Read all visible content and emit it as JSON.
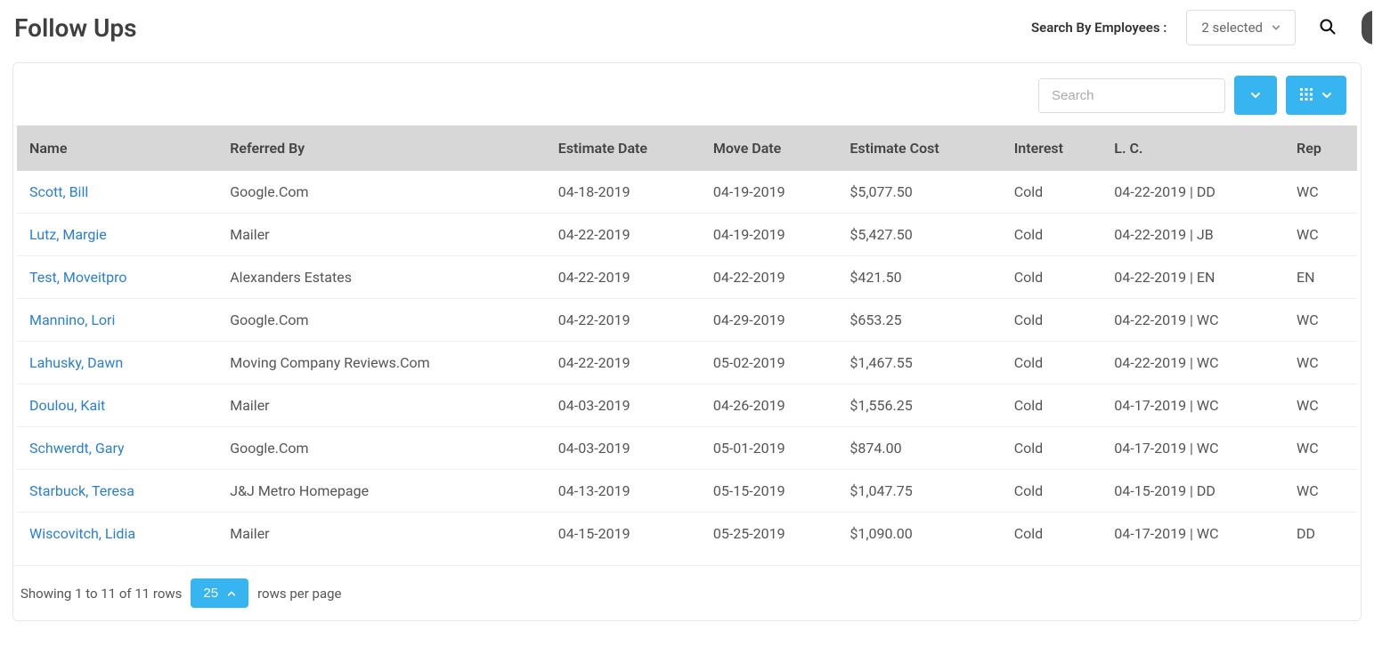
{
  "header": {
    "title": "Follow Ups",
    "searchByLabel": "Search By Employees :",
    "employeesSelected": "2 selected"
  },
  "toolbar": {
    "searchPlaceholder": "Search"
  },
  "table": {
    "columns": {
      "name": "Name",
      "referredBy": "Referred By",
      "estimateDate": "Estimate Date",
      "moveDate": "Move Date",
      "estimateCost": "Estimate Cost",
      "interest": "Interest",
      "lc": "L. C.",
      "rep": "Rep"
    },
    "rows": [
      {
        "name": "Scott, Bill",
        "referredBy": "Google.Com",
        "estimateDate": "04-18-2019",
        "moveDate": "04-19-2019",
        "estimateCost": "$5,077.50",
        "interest": "Cold",
        "lc": "04-22-2019 | DD",
        "rep": "WC"
      },
      {
        "name": "Lutz, Margie",
        "referredBy": "Mailer",
        "estimateDate": "04-22-2019",
        "moveDate": "04-19-2019",
        "estimateCost": "$5,427.50",
        "interest": "Cold",
        "lc": "04-22-2019 | JB",
        "rep": "WC"
      },
      {
        "name": "Test, Moveitpro",
        "referredBy": "Alexanders Estates",
        "estimateDate": "04-22-2019",
        "moveDate": "04-22-2019",
        "estimateCost": "$421.50",
        "interest": "Cold",
        "lc": "04-22-2019 | EN",
        "rep": "EN"
      },
      {
        "name": "Mannino, Lori",
        "referredBy": "Google.Com",
        "estimateDate": "04-22-2019",
        "moveDate": "04-29-2019",
        "estimateCost": "$653.25",
        "interest": "Cold",
        "lc": "04-22-2019 | WC",
        "rep": "WC"
      },
      {
        "name": "Lahusky, Dawn",
        "referredBy": "Moving Company Reviews.Com",
        "estimateDate": "04-22-2019",
        "moveDate": "05-02-2019",
        "estimateCost": "$1,467.55",
        "interest": "Cold",
        "lc": "04-22-2019 | WC",
        "rep": "WC"
      },
      {
        "name": "Doulou, Kait",
        "referredBy": "Mailer",
        "estimateDate": "04-03-2019",
        "moveDate": "04-26-2019",
        "estimateCost": "$1,556.25",
        "interest": "Cold",
        "lc": "04-17-2019 | WC",
        "rep": "WC"
      },
      {
        "name": "Schwerdt, Gary",
        "referredBy": "Google.Com",
        "estimateDate": "04-03-2019",
        "moveDate": "05-01-2019",
        "estimateCost": "$874.00",
        "interest": "Cold",
        "lc": "04-17-2019 | WC",
        "rep": "WC"
      },
      {
        "name": "Starbuck, Teresa",
        "referredBy": "J&J Metro Homepage",
        "estimateDate": "04-13-2019",
        "moveDate": "05-15-2019",
        "estimateCost": "$1,047.75",
        "interest": "Cold",
        "lc": "04-15-2019 | DD",
        "rep": "WC"
      },
      {
        "name": "Wiscovitch, Lidia",
        "referredBy": "Mailer",
        "estimateDate": "04-15-2019",
        "moveDate": "05-25-2019",
        "estimateCost": "$1,090.00",
        "interest": "Cold",
        "lc": "04-17-2019 | WC",
        "rep": "DD"
      }
    ]
  },
  "footer": {
    "showingText": "Showing 1 to 11 of 11 rows",
    "pageSize": "25",
    "rowsPerPage": "rows per page"
  }
}
